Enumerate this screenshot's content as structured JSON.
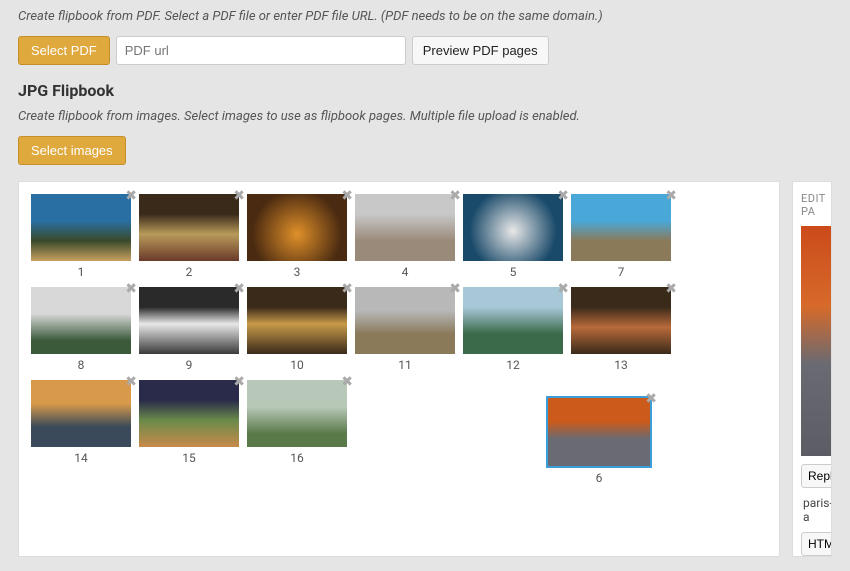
{
  "pdf": {
    "desc": "Create flipbook from PDF. Select a PDF file or enter PDF file URL. (PDF needs to be on the same domain.)",
    "select_label": "Select PDF",
    "url_placeholder": "PDF url",
    "preview_label": "Preview PDF pages"
  },
  "jpg": {
    "heading": "JPG Flipbook",
    "desc": "Create flipbook from images. Select images to use as flipbook pages. Multiple file upload is enabled.",
    "select_label": "Select images"
  },
  "thumbs": [
    {
      "n": "1",
      "cls": "t1"
    },
    {
      "n": "2",
      "cls": "t2"
    },
    {
      "n": "3",
      "cls": "t3"
    },
    {
      "n": "4",
      "cls": "t4"
    },
    {
      "n": "5",
      "cls": "t5"
    },
    {
      "n": "7",
      "cls": "t7"
    },
    {
      "n": "8",
      "cls": "t8"
    },
    {
      "n": "9",
      "cls": "t9"
    },
    {
      "n": "10",
      "cls": "t10"
    },
    {
      "n": "11",
      "cls": "t11"
    },
    {
      "n": "12",
      "cls": "t12"
    },
    {
      "n": "13",
      "cls": "t13"
    },
    {
      "n": "14",
      "cls": "t14"
    },
    {
      "n": "15",
      "cls": "t15"
    },
    {
      "n": "16",
      "cls": "t16"
    }
  ],
  "dragged": {
    "n": "6",
    "cls": "t6"
  },
  "side": {
    "title": "EDIT PA",
    "replace": "Repla",
    "filename": "paris-a",
    "html": "HTMI"
  },
  "close_glyph": "✖"
}
